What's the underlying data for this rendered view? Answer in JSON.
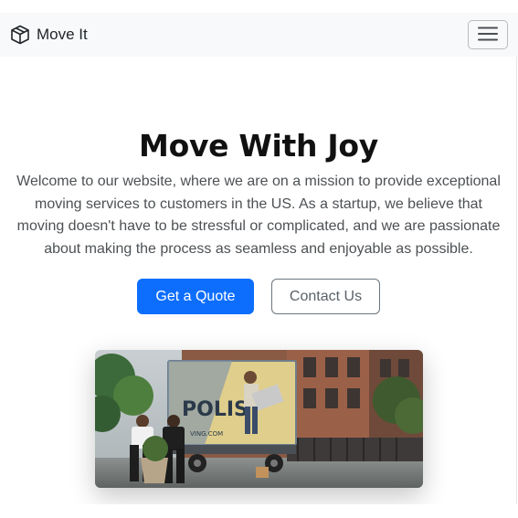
{
  "navbar": {
    "brand_name": "Move It",
    "brand_icon": "box-icon",
    "toggler_icon": "hamburger-menu-icon",
    "background": "#f8f9fa"
  },
  "hero": {
    "title": "Move With Joy",
    "description": "Welcome to our website, where we are on a mission to provide exceptional moving services to customers in the US. As a startup, we believe that moving doesn't have to be stressful or complicated, and we are passionate about making the process as seamless and enjoyable as possible.",
    "primary_button": "Get a Quote",
    "secondary_button": "Contact Us",
    "image_truck_text": "POLIS",
    "image_truck_subtext": "VING.COM"
  },
  "colors": {
    "primary": "#0d6efd",
    "outline": "#6c757d",
    "text": "#212529"
  }
}
